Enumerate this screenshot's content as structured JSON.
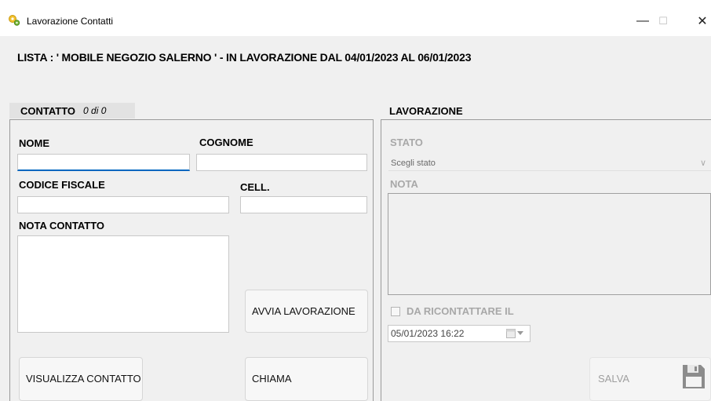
{
  "window": {
    "title": "Lavorazione Contatti",
    "minimize_glyph": "—",
    "maximize_glyph": "☐",
    "close_glyph": "✕",
    "icon": "app-gear-icon"
  },
  "header": {
    "list_info": "LISTA : ' MOBILE NEGOZIO SALERNO ' - IN LAVORAZIONE DAL 04/01/2023 AL 06/01/2023"
  },
  "contatto": {
    "section_label": "CONTATTO",
    "counter": "0 di 0",
    "nome_label": "NOME",
    "nome_value": "",
    "cognome_label": "COGNOME",
    "cognome_value": "",
    "codice_fiscale_label": "CODICE FISCALE",
    "codice_fiscale_value": "",
    "cell_label": "CELL.",
    "cell_value": "",
    "nota_label": "NOTA CONTATTO",
    "nota_value": "",
    "avvia_button": "AVVIA LAVORAZIONE",
    "visualizza_button": "VISUALIZZA CONTATTO",
    "chiama_button": "CHIAMA"
  },
  "lavorazione": {
    "section_label": "LAVORAZIONE",
    "stato_label": "STATO",
    "stato_selected": "Scegli stato",
    "nota_label": "NOTA",
    "nota_value": "",
    "ricontattare_label": "DA RICONTATTARE IL",
    "ricontattare_checked": false,
    "date_value": "05/01/2023 16:22",
    "salva_button": "SALVA",
    "save_icon": "floppy-disk-icon"
  },
  "colors": {
    "focus_accent": "#0067c0",
    "disabled_text": "#a8a8a8",
    "background": "#f0f0f0"
  }
}
